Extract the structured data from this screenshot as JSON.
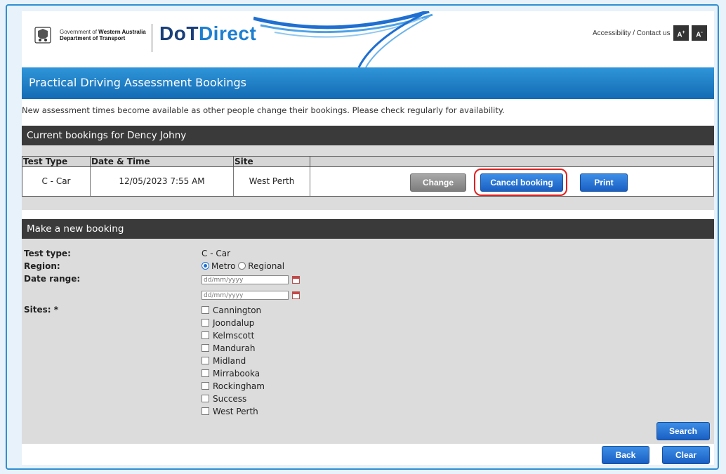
{
  "header": {
    "gov_line1_prefix": "Government of",
    "gov_line1_bold": "Western Australia",
    "gov_line2": "Department of Transport",
    "logo_part1": "DoT",
    "logo_part2": "Direct",
    "accessibility_link": "Accessibility / Contact us",
    "font_increase": "A",
    "font_increase_sup": "+",
    "font_decrease": "A",
    "font_decrease_sup": "-"
  },
  "page_title": "Practical Driving Assessment Bookings",
  "notice": "New assessment times become available as other people change their bookings. Please check regularly for availability.",
  "current_bookings": {
    "heading": "Current bookings for Dency Johny",
    "columns": [
      "Test Type",
      "Date & Time",
      "Site"
    ],
    "row": {
      "test_type": "C - Car",
      "date_time": "12/05/2023 7:55 AM",
      "site": "West Perth"
    },
    "buttons": {
      "change": "Change",
      "cancel": "Cancel booking",
      "print": "Print"
    }
  },
  "new_booking": {
    "heading": "Make a new booking",
    "test_type_label": "Test type:",
    "test_type_value": "C - Car",
    "region_label": "Region:",
    "region_options": [
      "Metro",
      "Regional"
    ],
    "region_selected": "Metro",
    "date_range_label": "Date range:",
    "date_placeholder": "dd/mm/yyyy",
    "sites_label": "Sites:  *",
    "sites": [
      "Cannington",
      "Joondalup",
      "Kelmscott",
      "Mandurah",
      "Midland",
      "Mirrabooka",
      "Rockingham",
      "Success",
      "West Perth"
    ],
    "search_button": "Search",
    "back_button": "Back",
    "clear_button": "Clear"
  },
  "colors": {
    "primary_blue": "#1a5fc4",
    "title_bar": "#2f95d9",
    "section_dark": "#3a3a3a",
    "highlight_red": "#e02020"
  }
}
